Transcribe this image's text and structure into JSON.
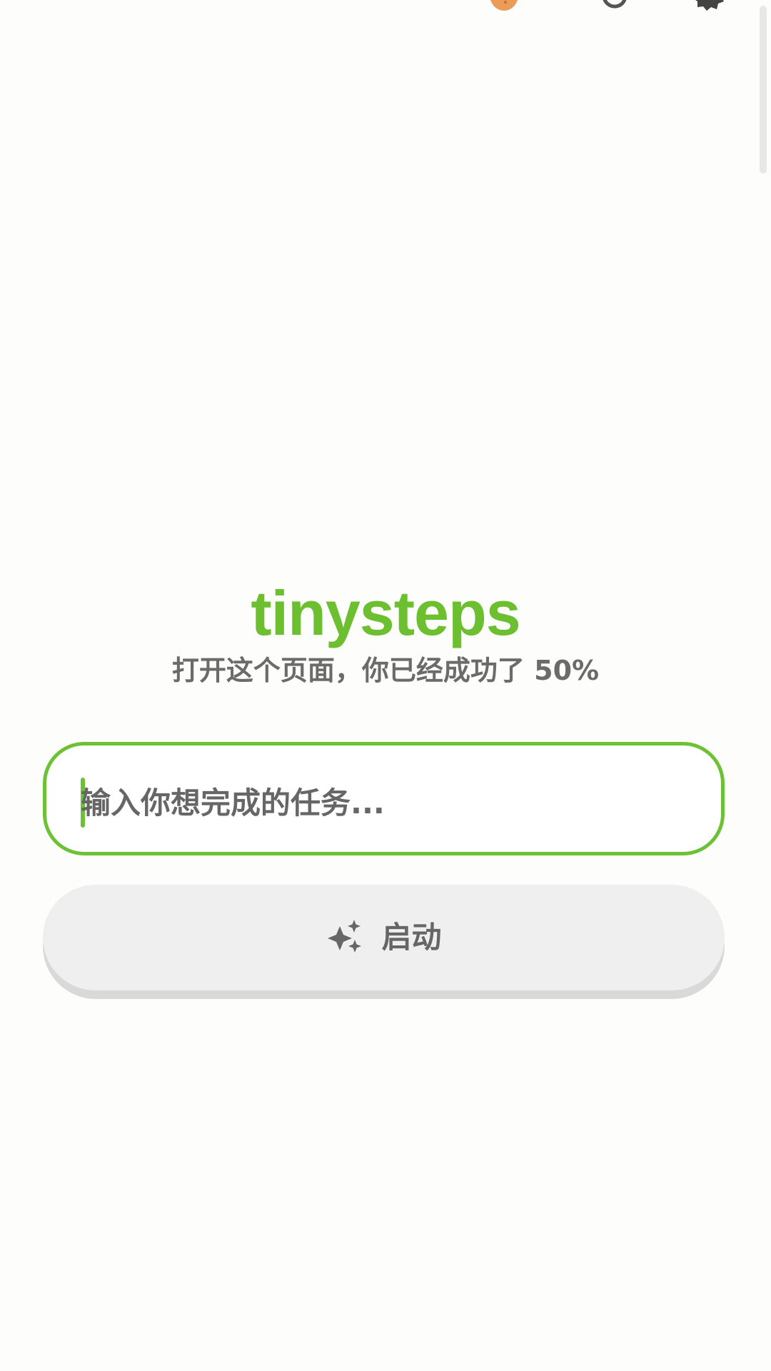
{
  "app": {
    "brand": "tinysteps",
    "subtitle": "打开这个页面，你已经成功了 50%"
  },
  "topbar": {
    "icons": [
      "egg-icon",
      "history-icon",
      "settings-icon"
    ]
  },
  "task": {
    "placeholder": "输入你想完成的任务..."
  },
  "actions": {
    "launch_label": "启动",
    "launch_icon": "sparkle-icon"
  },
  "colors": {
    "accent": "#6cbf2f",
    "button_bg": "#efefef",
    "text_muted": "#6b6b6b"
  }
}
